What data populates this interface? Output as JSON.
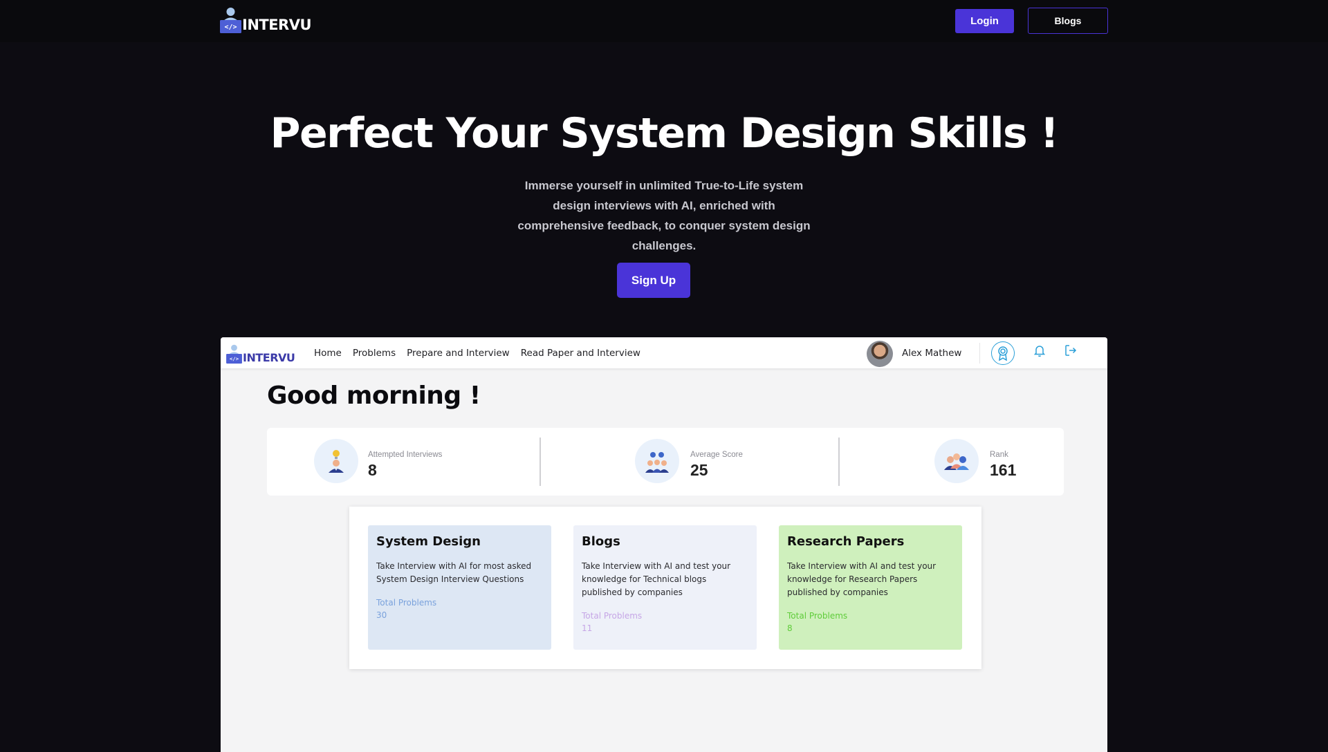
{
  "brand": {
    "name": "INTERVU"
  },
  "topnav": {
    "login_label": "Login",
    "blogs_label": "Blogs"
  },
  "hero": {
    "title": "Perfect Your System Design Skills !",
    "subtitle": "Immerse yourself in unlimited True-to-Life system design interviews with AI, enriched with comprehensive feedback, to conquer system design challenges.",
    "signup_label": "Sign Up"
  },
  "app": {
    "nav": {
      "links": [
        "Home",
        "Problems",
        "Prepare and Interview",
        "Read Paper and Interview"
      ],
      "user_name": "Alex Mathew"
    },
    "greeting": "Good morning !",
    "stats": [
      {
        "label": "Attempted Interviews",
        "value": "8",
        "icon": "lightbulb-person-icon"
      },
      {
        "label": "Average Score",
        "value": "25",
        "icon": "team-icon"
      },
      {
        "label": "Rank",
        "value": "161",
        "icon": "group-icon"
      }
    ],
    "cards": [
      {
        "title": "System Design",
        "description": "Take Interview with AI for most asked System Design Interview Questions",
        "count_label": "Total Problems",
        "count": "30",
        "color": "#dde7f4"
      },
      {
        "title": "Blogs",
        "description": "Take Interview with AI and test your knowledge for Technical blogs published by companies",
        "count_label": "Total Problems",
        "count": "11",
        "color": "#eef1f9"
      },
      {
        "title": "Research Papers",
        "description": "Take Interview with AI and test your knowledge for Research Papers published by companies",
        "count_label": "Total Problems",
        "count": "8",
        "color": "#cff0bd"
      }
    ]
  },
  "colors": {
    "accent": "#4a34d8",
    "background": "#0d0c12",
    "link_icon": "#2a9fd8"
  }
}
